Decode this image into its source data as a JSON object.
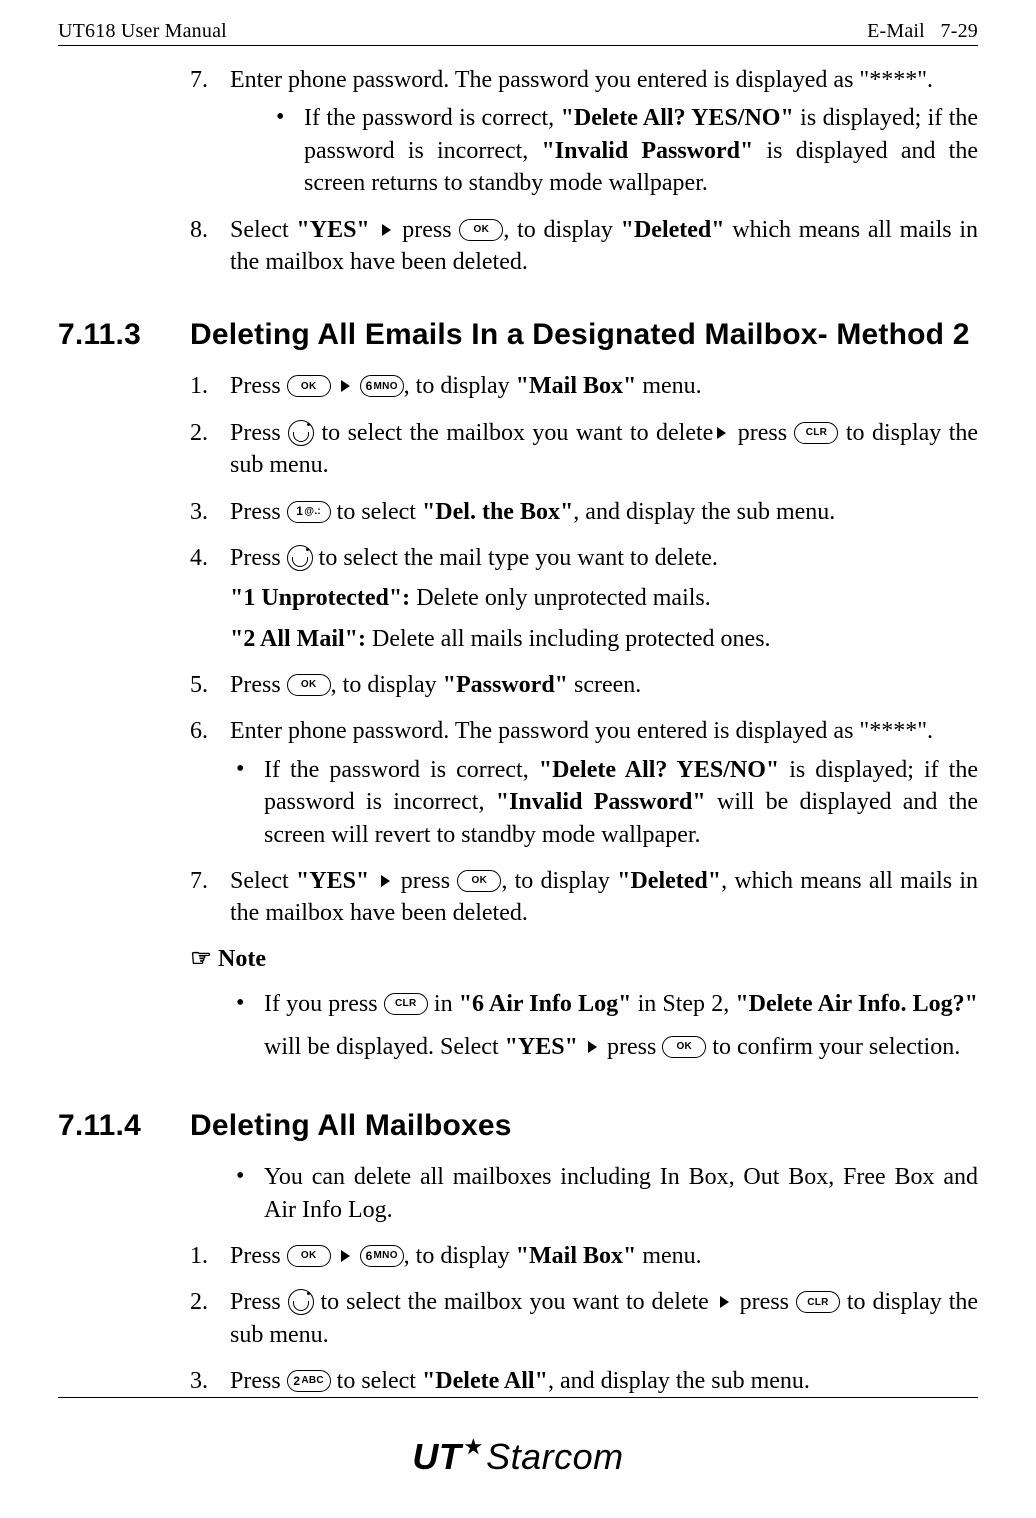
{
  "header": {
    "left": "UT618 User Manual",
    "right_section": "E-Mail",
    "right_page": "7-29"
  },
  "intro_steps": [
    {
      "num": "7",
      "text": "Enter phone password. The password you entered is displayed as \"****\"."
    },
    {
      "num": "8",
      "pre": "Select ",
      "b1": "\"YES\"",
      "mid1": " ",
      "mid2": " press ",
      "post": ", to display ",
      "b2": "\"Deleted\"",
      "tail": " which means all mails in the mailbox have been deleted."
    }
  ],
  "intro_bullet": {
    "pre": "If the password is correct, ",
    "b1": "\"Delete All? YES/NO\"",
    "mid": " is displayed; if the password is incorrect, ",
    "b2": "\"Invalid Password\"",
    "tail": " is displayed and the screen returns to standby mode wallpaper."
  },
  "sec1": {
    "number": "7.11.3",
    "title": "Deleting All Emails In a Designated Mailbox- Method 2",
    "steps": {
      "s1": {
        "num": "1",
        "pre": "Press ",
        "post": ", to display ",
        "b": "\"Mail Box\"",
        "tail": " menu."
      },
      "s2": {
        "num": "2",
        "pre": "Press ",
        "mid1": " to select the mailbox you want to delete",
        "mid2": " press ",
        "tail": " to display the sub menu."
      },
      "s3": {
        "num": "3",
        "pre": "Press ",
        "mid": " to select ",
        "b": "\"Del. the Box\"",
        "tail": ", and display the sub menu."
      },
      "s4": {
        "num": "4",
        "pre": "Press ",
        "tail": " to select the mail type you want to delete."
      },
      "s4a": {
        "b": "\"1 Unprotected\":",
        "t": " Delete only unprotected mails."
      },
      "s4b": {
        "b": "\"2 All Mail\":",
        "t": " Delete all mails including protected ones."
      },
      "s5": {
        "num": "5",
        "pre": "Press ",
        "post": ", to display ",
        "b": "\"Password\"",
        "tail": " screen."
      },
      "s6": {
        "num": "6",
        "text": "Enter phone password. The password you entered is displayed as \"****\"."
      },
      "s6_bullet": {
        "pre": "If the password is correct, ",
        "b1": "\"Delete All? YES/NO\"",
        "mid": " is displayed; if the password is incorrect, ",
        "b2": "\"Invalid Password\"",
        "tail": " will be displayed and the screen will revert to standby mode wallpaper."
      },
      "s7": {
        "num": "7",
        "pre": "Select ",
        "b1": "\"YES\"",
        "mid1": " ",
        "mid2": " press ",
        "post": ", to display ",
        "b2": "\"Deleted\"",
        "tail": ", which means all mails in the mailbox have been deleted."
      }
    },
    "note_label": "Note",
    "note_bullet": {
      "pre": "If you press ",
      "mid1": " in ",
      "b1": "\"6 Air Info Log\"",
      "mid2": " in Step 2, ",
      "b2": "\"Delete Air Info. Log?\"",
      "mid3": " will be displayed. Select ",
      "b3": "\"YES\"",
      "mid4": " ",
      "mid5": " press ",
      "tail": " to confirm your selection."
    }
  },
  "sec2": {
    "number": "7.11.4",
    "title": "Deleting All Mailboxes",
    "lead_bullet": "You can delete all mailboxes including In Box, Out Box, Free Box and Air Info Log.",
    "steps": {
      "s1": {
        "num": "1",
        "pre": "Press ",
        "post": ", to display ",
        "b": "\"Mail Box\"",
        "tail": " menu."
      },
      "s2": {
        "num": "2",
        "pre": "Press ",
        "mid1": " to select the mailbox you want to delete ",
        "mid2": " press ",
        "tail": " to display the sub menu."
      },
      "s3": {
        "num": "3",
        "pre": "Press ",
        "mid": " to select ",
        "b": "\"Delete All\"",
        "tail": ", and display the sub menu."
      }
    }
  },
  "keys": {
    "ok": "OK",
    "clr": "CLR",
    "k6": {
      "big": "6",
      "small": "MNO"
    },
    "k1": {
      "big": "1",
      "small": "@.:"
    },
    "k2": {
      "big": "2",
      "small": "ABC"
    }
  },
  "logo": {
    "ut": "UT",
    "starcom": "Starcom"
  }
}
